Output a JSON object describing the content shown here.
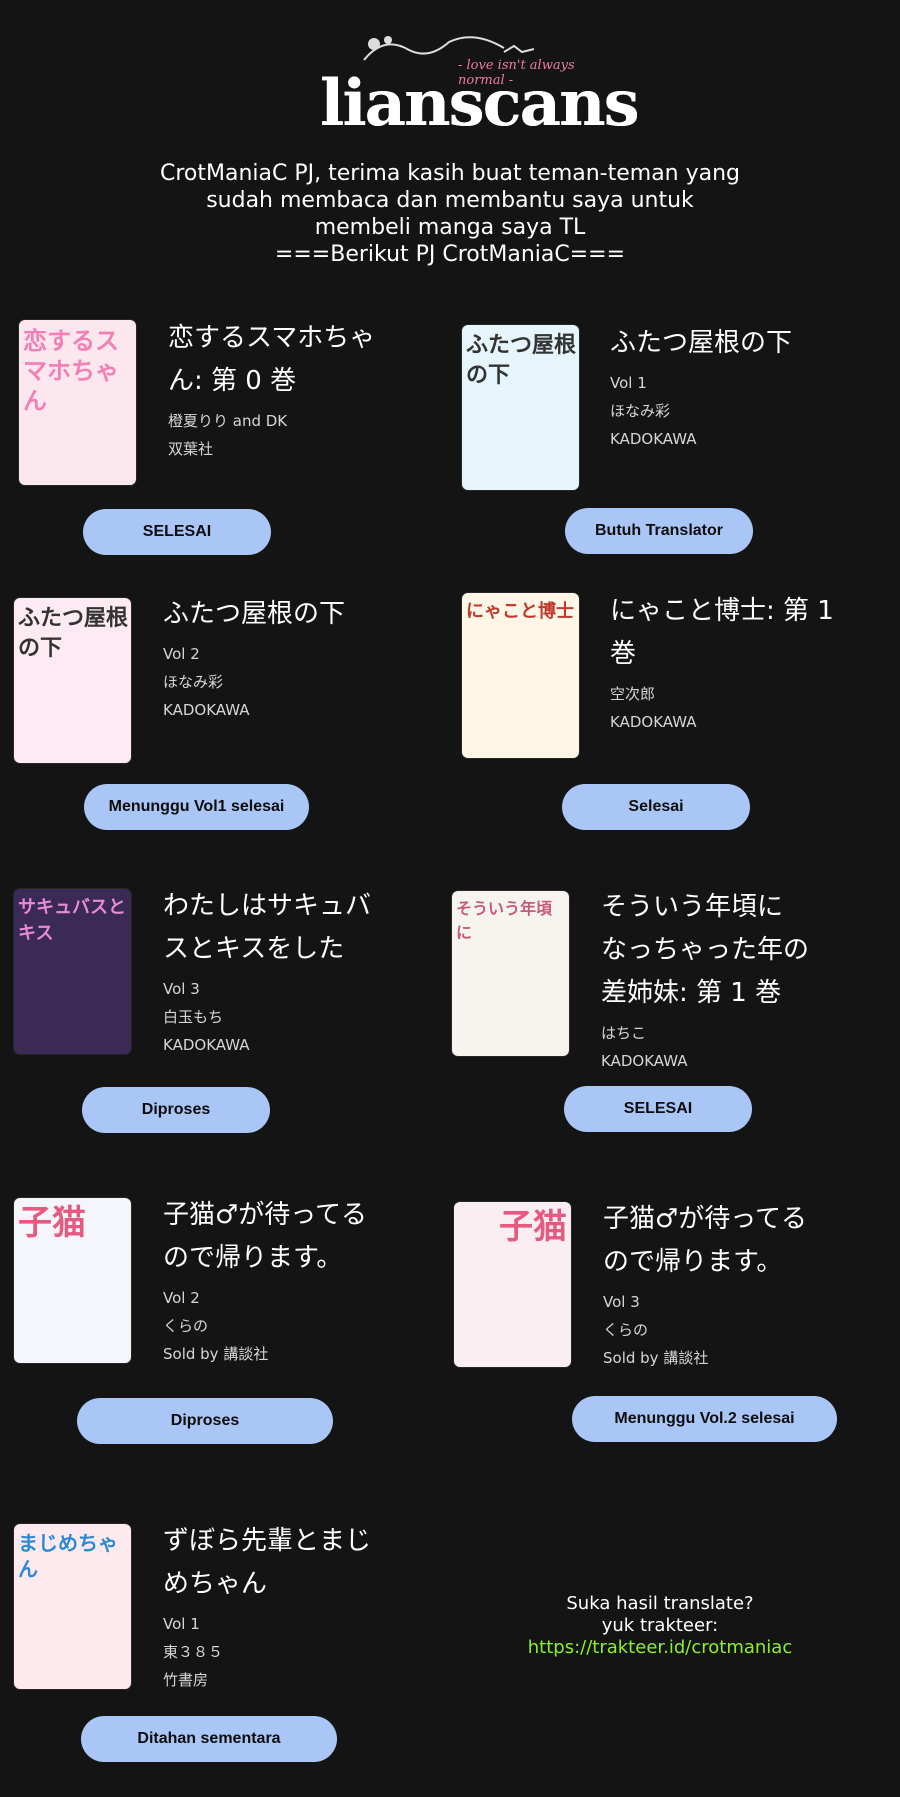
{
  "logo": {
    "wordmark": "lianscans",
    "tagline": "- love isn't always normal -",
    "colors": {
      "pink": "#e34a72",
      "white": "#ffffff"
    }
  },
  "intro": {
    "line1": "CrotManiaC PJ, terima kasih buat teman-teman yang",
    "line2": "sudah membaca dan membantu saya untuk",
    "line3": "membeli manga saya TL",
    "line4": "===Berikut PJ CrotManiaC==="
  },
  "manga": [
    {
      "title_line1": "恋するスマホちゃ",
      "title_line2": "ん: 第 0 巻",
      "meta1": "橙夏りり and DK",
      "meta2": "双葉社",
      "status": "SELESAI",
      "cover_text": "恋するスマホちゃん",
      "cover_color": "#f27fb6"
    },
    {
      "title_line1": "ふたつ屋根の下",
      "meta1": "Vol 1",
      "meta2": "ほなみ彩",
      "meta3": "KADOKAWA",
      "status": "Butuh Translator",
      "cover_text": "ふたつ屋根の下",
      "cover_color": "#7ec8e6"
    },
    {
      "title_line1": "ふたつ屋根の下",
      "meta1": "Vol 2",
      "meta2": "ほなみ彩",
      "meta3": "KADOKAWA",
      "status": "Menunggu Vol1 selesai",
      "cover_text": "ふたつ屋根の下",
      "cover_color": "#f4a7c8"
    },
    {
      "title_line1": "にゃこと博士: 第 1",
      "title_line2": "巻",
      "meta1": "空次郎",
      "meta2": "KADOKAWA",
      "status": "Selesai",
      "cover_text": "にゃこと博士",
      "cover_color": "#f3b66a"
    },
    {
      "title_line1": "わたしはサキュバ",
      "title_line2": "スとキスをした",
      "meta1": "Vol 3",
      "meta2": "白玉もち",
      "meta3": "KADOKAWA",
      "status": "Diproses",
      "cover_text": "サキュバスとキス",
      "cover_color": "#c56ec8"
    },
    {
      "title_line1": "そういう年頃に",
      "title_line2": "なっちゃった年の",
      "title_line3": "差姉妹: 第 1 巻",
      "meta1": "はちこ",
      "meta2": "KADOKAWA",
      "status": "SELESAI",
      "cover_text": "そういう年頃に",
      "cover_color": "#3a4a66"
    },
    {
      "title_line1": "子猫♂が待ってる",
      "title_line2": "ので帰ります。",
      "meta1": "Vol 2",
      "meta2": "くらの",
      "meta3": "Sold by 講談社",
      "status": "Diproses",
      "cover_text": "子猫",
      "cover_color": "#e65a82"
    },
    {
      "title_line1": "子猫♂が待ってる",
      "title_line2": "ので帰ります。",
      "meta1": "Vol 3",
      "meta2": "くらの",
      "meta3": "Sold by 講談社",
      "status": "Menunggu Vol.2 selesai",
      "cover_text": "子猫",
      "cover_color": "#e65a82"
    },
    {
      "title_line1": "ずぼら先輩とまじ",
      "title_line2": "めちゃん",
      "meta1": "Vol 1",
      "meta2": "東３８５",
      "meta3": "竹書房",
      "status": "Ditahan sementara",
      "cover_text": "まじめちゃん",
      "cover_color": "#f06b8d"
    }
  ],
  "support": {
    "line1": "Suka hasil translate?",
    "line2": "yuk trakteer:",
    "link": "https://trakteer.id/crotmaniac"
  }
}
